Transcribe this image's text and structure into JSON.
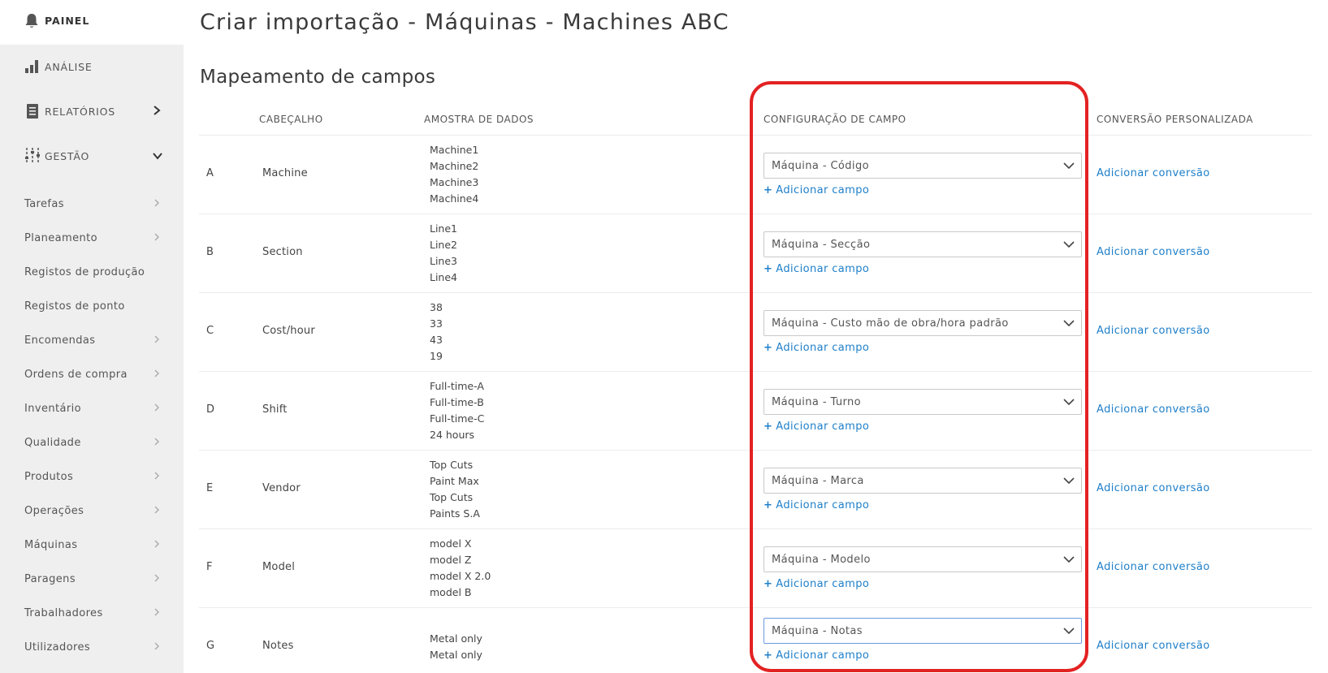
{
  "sidebar": {
    "painel": "PAINEL",
    "main_items": [
      {
        "label": "ANÁLISE",
        "icon": "bar-chart-icon"
      },
      {
        "label": "RELATÓRIOS",
        "icon": "document-icon"
      },
      {
        "label": "GESTÃO",
        "icon": "sliders-icon"
      }
    ],
    "sub_items": [
      {
        "label": "Tarefas",
        "chevron": true
      },
      {
        "label": "Planeamento",
        "chevron": true
      },
      {
        "label": "Registos de produção",
        "chevron": false
      },
      {
        "label": "Registos de ponto",
        "chevron": false
      },
      {
        "label": "Encomendas",
        "chevron": true
      },
      {
        "label": "Ordens de compra",
        "chevron": true
      },
      {
        "label": "Inventário",
        "chevron": true
      },
      {
        "label": "Qualidade",
        "chevron": true
      },
      {
        "label": "Produtos",
        "chevron": true
      },
      {
        "label": "Operações",
        "chevron": true
      },
      {
        "label": "Máquinas",
        "chevron": true
      },
      {
        "label": "Paragens",
        "chevron": true
      },
      {
        "label": "Trabalhadores",
        "chevron": true
      },
      {
        "label": "Utilizadores",
        "chevron": true
      }
    ]
  },
  "page": {
    "title": "Criar importação - Máquinas - Machines ABC",
    "section_title": "Mapeamento de campos"
  },
  "table": {
    "headers": {
      "header": "CABEÇALHO",
      "sample": "AMOSTRA DE DADOS",
      "config": "CONFIGURAÇÃO DE CAMPO",
      "conversion": "CONVERSÃO PERSONALIZADA"
    },
    "add_field_label": "Adicionar campo",
    "add_conversion_label": "Adicionar conversão",
    "rows": [
      {
        "col": "A",
        "header": "Machine",
        "samples": [
          "Machine1",
          "Machine2",
          "Machine3",
          "Machine4"
        ],
        "field": "Máquina - Código"
      },
      {
        "col": "B",
        "header": "Section",
        "samples": [
          "Line1",
          "Line2",
          "Line3",
          "Line4"
        ],
        "field": "Máquina - Secção"
      },
      {
        "col": "C",
        "header": "Cost/hour",
        "samples": [
          "38",
          "33",
          "43",
          "19"
        ],
        "field": "Máquina - Custo mão de obra/hora padrão"
      },
      {
        "col": "D",
        "header": "Shift",
        "samples": [
          "Full-time-A",
          "Full-time-B",
          "Full-time-C",
          "24 hours"
        ],
        "field": "Máquina - Turno"
      },
      {
        "col": "E",
        "header": "Vendor",
        "samples": [
          "Top Cuts",
          "Paint Max",
          "Top Cuts",
          "Paints S.A"
        ],
        "field": "Máquina - Marca"
      },
      {
        "col": "F",
        "header": "Model",
        "samples": [
          "model X",
          "model Z",
          "model X 2.0",
          "model B"
        ],
        "field": "Máquina - Modelo"
      },
      {
        "col": "G",
        "header": "Notes",
        "samples": [
          "Metal only",
          "Metal only"
        ],
        "field": "Máquina - Notas"
      }
    ]
  },
  "colors": {
    "link": "#1e7fc9",
    "highlight": "#e32222",
    "sidebar_bg": "#efefef"
  }
}
